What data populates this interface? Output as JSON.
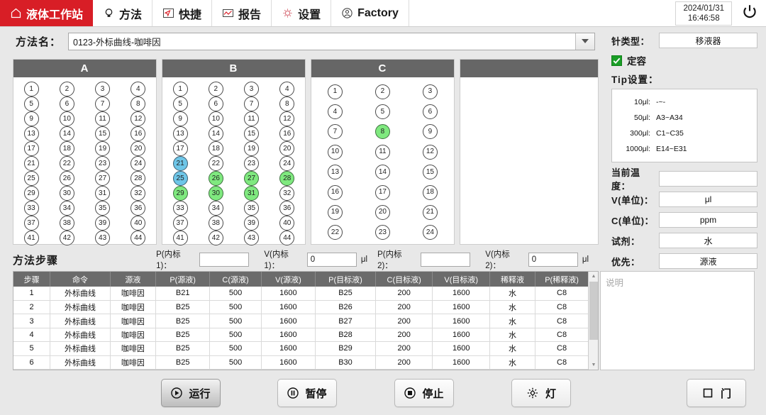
{
  "app": {
    "brand": "液体工作站",
    "accent": "#d81e26",
    "datetime_date": "2024/01/31",
    "datetime_time": "16:46:58"
  },
  "topbar": {
    "tabs": [
      {
        "label": "液体工作站",
        "icon": "home-icon",
        "active": true
      },
      {
        "label": "方法",
        "icon": "lightbulb-icon",
        "active": false
      },
      {
        "label": "快捷",
        "icon": "cursor-box-icon",
        "active": false
      },
      {
        "label": "报告",
        "icon": "chart-box-icon",
        "active": false
      },
      {
        "label": "设置",
        "icon": "gear-icon",
        "active": false
      },
      {
        "label": "Factory",
        "icon": "user-circle-icon",
        "active": false
      }
    ],
    "power_icon": "power-icon"
  },
  "method": {
    "label": "方法名：",
    "value": "0123-外标曲线-咖啡因",
    "placeholder": "方法名",
    "dropdown_icon": "chevron-down-icon"
  },
  "racks": [
    {
      "title": "A",
      "cols": 4,
      "rows": 11,
      "wells": [
        {
          "n": "1"
        },
        {
          "n": "2"
        },
        {
          "n": "3"
        },
        {
          "n": "4"
        },
        {
          "n": "5"
        },
        {
          "n": "6"
        },
        {
          "n": "7"
        },
        {
          "n": "8"
        },
        {
          "n": "9"
        },
        {
          "n": "10"
        },
        {
          "n": "11"
        },
        {
          "n": "12"
        },
        {
          "n": "13"
        },
        {
          "n": "14"
        },
        {
          "n": "15"
        },
        {
          "n": "16"
        },
        {
          "n": "17"
        },
        {
          "n": "18"
        },
        {
          "n": "19"
        },
        {
          "n": "20"
        },
        {
          "n": "21"
        },
        {
          "n": "22"
        },
        {
          "n": "23"
        },
        {
          "n": "24"
        },
        {
          "n": "25"
        },
        {
          "n": "26"
        },
        {
          "n": "27"
        },
        {
          "n": "28"
        },
        {
          "n": "29"
        },
        {
          "n": "30"
        },
        {
          "n": "31"
        },
        {
          "n": "32"
        },
        {
          "n": "33"
        },
        {
          "n": "34"
        },
        {
          "n": "35"
        },
        {
          "n": "36"
        },
        {
          "n": "37"
        },
        {
          "n": "38"
        },
        {
          "n": "39"
        },
        {
          "n": "40"
        },
        {
          "n": "41"
        },
        {
          "n": "42"
        },
        {
          "n": "43"
        },
        {
          "n": "44"
        }
      ]
    },
    {
      "title": "B",
      "cols": 4,
      "rows": 11,
      "wells": [
        {
          "n": "1"
        },
        {
          "n": "2"
        },
        {
          "n": "3"
        },
        {
          "n": "4"
        },
        {
          "n": "5"
        },
        {
          "n": "6"
        },
        {
          "n": "7"
        },
        {
          "n": "8"
        },
        {
          "n": "9"
        },
        {
          "n": "10"
        },
        {
          "n": "11"
        },
        {
          "n": "12"
        },
        {
          "n": "13"
        },
        {
          "n": "14"
        },
        {
          "n": "15"
        },
        {
          "n": "16"
        },
        {
          "n": "17"
        },
        {
          "n": "18"
        },
        {
          "n": "19"
        },
        {
          "n": "20"
        },
        {
          "n": "21",
          "state": "blue"
        },
        {
          "n": "22"
        },
        {
          "n": "23"
        },
        {
          "n": "24"
        },
        {
          "n": "25",
          "state": "blue"
        },
        {
          "n": "26",
          "state": "green"
        },
        {
          "n": "27",
          "state": "green"
        },
        {
          "n": "28",
          "state": "green"
        },
        {
          "n": "29",
          "state": "green"
        },
        {
          "n": "30",
          "state": "green"
        },
        {
          "n": "31",
          "state": "green"
        },
        {
          "n": "32"
        },
        {
          "n": "33"
        },
        {
          "n": "34"
        },
        {
          "n": "35"
        },
        {
          "n": "36"
        },
        {
          "n": "37"
        },
        {
          "n": "38"
        },
        {
          "n": "39"
        },
        {
          "n": "40"
        },
        {
          "n": "41"
        },
        {
          "n": "42"
        },
        {
          "n": "43"
        },
        {
          "n": "44"
        }
      ]
    },
    {
      "title": "C",
      "cols": 3,
      "rows": 8,
      "wells": [
        {
          "n": "1"
        },
        {
          "n": "2"
        },
        {
          "n": "3"
        },
        {
          "n": "4"
        },
        {
          "n": "5"
        },
        {
          "n": "6"
        },
        {
          "n": "7"
        },
        {
          "n": "8",
          "state": "green"
        },
        {
          "n": "9"
        },
        {
          "n": "10"
        },
        {
          "n": "11"
        },
        {
          "n": "12"
        },
        {
          "n": "13"
        },
        {
          "n": "14"
        },
        {
          "n": "15"
        },
        {
          "n": "16"
        },
        {
          "n": "17"
        },
        {
          "n": "18"
        },
        {
          "n": "19"
        },
        {
          "n": "20"
        },
        {
          "n": "21"
        },
        {
          "n": "22"
        },
        {
          "n": "23"
        },
        {
          "n": "24"
        }
      ]
    },
    {
      "title": "",
      "cols": 0,
      "rows": 0,
      "wells": []
    }
  ],
  "well_colors": {
    "blue": "#6ec6e8",
    "green": "#7fe97f",
    "empty": "#ffffff"
  },
  "steps_section": {
    "title": "方法步骤",
    "internal_standards": [
      {
        "p_label": "P(内标1)：",
        "p_value": "",
        "v_label": "V(内标1)：",
        "v_value": "0",
        "unit": "μl"
      },
      {
        "p_label": "P(内标2)：",
        "p_value": "",
        "v_label": "V(内标2)：",
        "v_value": "0",
        "unit": "μl"
      }
    ],
    "columns": [
      "步骤",
      "命令",
      "源液",
      "P(源液)",
      "C(源液)",
      "V(源液)",
      "P(目标液)",
      "C(目标液)",
      "V(目标液)",
      "稀释液",
      "P(稀释液)"
    ],
    "rows": [
      [
        "1",
        "外标曲线",
        "咖啡因",
        "B21",
        "500",
        "1600",
        "B25",
        "200",
        "1600",
        "水",
        "C8"
      ],
      [
        "2",
        "外标曲线",
        "咖啡因",
        "B25",
        "500",
        "1600",
        "B26",
        "200",
        "1600",
        "水",
        "C8"
      ],
      [
        "3",
        "外标曲线",
        "咖啡因",
        "B25",
        "500",
        "1600",
        "B27",
        "200",
        "1600",
        "水",
        "C8"
      ],
      [
        "4",
        "外标曲线",
        "咖啡因",
        "B25",
        "500",
        "1600",
        "B28",
        "200",
        "1600",
        "水",
        "C8"
      ],
      [
        "5",
        "外标曲线",
        "咖啡因",
        "B25",
        "500",
        "1600",
        "B29",
        "200",
        "1600",
        "水",
        "C8"
      ],
      [
        "6",
        "外标曲线",
        "咖啡因",
        "B25",
        "500",
        "1600",
        "B30",
        "200",
        "1600",
        "水",
        "C8"
      ]
    ]
  },
  "sidebar": {
    "needle": {
      "label": "针类型：",
      "value": "移液器"
    },
    "dingrong": {
      "label": "定容",
      "checked": true,
      "check_icon": "check-icon"
    },
    "tip_title": "Tip设置：",
    "tips": [
      {
        "key": "10μl:",
        "value": "-~-"
      },
      {
        "key": "50μl:",
        "value": "A3~A34"
      },
      {
        "key": "300μl:",
        "value": "C1~C35"
      },
      {
        "key": "1000μl:",
        "value": "E14~E31"
      }
    ],
    "fields": [
      {
        "label": "当前温度：",
        "value": ""
      },
      {
        "label": "V(单位)：",
        "value": "μl"
      },
      {
        "label": "C(单位)：",
        "value": "ppm"
      },
      {
        "label": "试剂：",
        "value": "水"
      },
      {
        "label": "优先：",
        "value": "源液"
      }
    ]
  },
  "description": {
    "placeholder": "说明",
    "value": ""
  },
  "buttons": [
    {
      "id": "run",
      "label": "运行",
      "icon": "play-circle-icon",
      "pressed": true
    },
    {
      "id": "pause",
      "label": "暂停",
      "icon": "pause-circle-icon",
      "pressed": false
    },
    {
      "id": "stop",
      "label": "停止",
      "icon": "stop-circle-icon",
      "pressed": false
    },
    {
      "id": "lamp",
      "label": "灯",
      "icon": "lamp-icon",
      "pressed": false
    },
    {
      "id": "door",
      "label": "门",
      "icon": "square-icon",
      "pressed": false
    }
  ]
}
